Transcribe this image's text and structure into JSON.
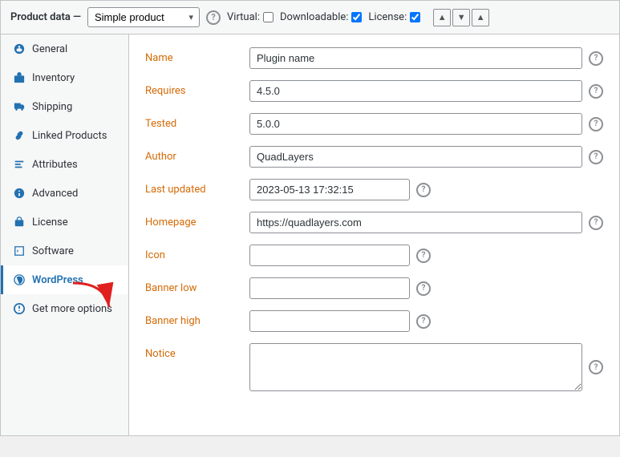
{
  "header": {
    "label": "Product data —",
    "product_type": "Simple product",
    "virtual_label": "Virtual:",
    "virtual_checked": false,
    "downloadable_label": "Downloadable:",
    "downloadable_checked": true,
    "license_label": "License:",
    "license_checked": true
  },
  "sidebar": {
    "items": [
      {
        "id": "general",
        "label": "General",
        "icon": "general"
      },
      {
        "id": "inventory",
        "label": "Inventory",
        "icon": "inventory"
      },
      {
        "id": "shipping",
        "label": "Shipping",
        "icon": "shipping"
      },
      {
        "id": "linked-products",
        "label": "Linked Products",
        "icon": "linked"
      },
      {
        "id": "attributes",
        "label": "Attributes",
        "icon": "attributes"
      },
      {
        "id": "advanced",
        "label": "Advanced",
        "icon": "advanced"
      },
      {
        "id": "license",
        "label": "License",
        "icon": "license"
      },
      {
        "id": "software",
        "label": "Software",
        "icon": "software"
      },
      {
        "id": "wordpress",
        "label": "WordPress",
        "icon": "wordpress",
        "active": true
      },
      {
        "id": "get-more-options",
        "label": "Get more options",
        "icon": "more"
      }
    ]
  },
  "form": {
    "fields": [
      {
        "id": "name",
        "label": "Name",
        "label_color": "orange",
        "type": "text",
        "value": "Plugin name",
        "placeholder": "",
        "short": false
      },
      {
        "id": "requires",
        "label": "Requires",
        "label_color": "orange",
        "type": "text",
        "value": "4.5.0",
        "placeholder": "",
        "short": false
      },
      {
        "id": "tested",
        "label": "Tested",
        "label_color": "orange",
        "type": "text",
        "value": "5.0.0",
        "placeholder": "",
        "short": false
      },
      {
        "id": "author",
        "label": "Author",
        "label_color": "orange",
        "type": "text",
        "value": "QuadLayers",
        "placeholder": "",
        "short": false
      },
      {
        "id": "last_updated",
        "label": "Last updated",
        "label_color": "orange",
        "type": "text",
        "value": "2023-05-13 17:32:15",
        "placeholder": "",
        "short": true
      },
      {
        "id": "homepage",
        "label": "Homepage",
        "label_color": "orange",
        "type": "text",
        "value": "https://quadlayers.com",
        "placeholder": "",
        "short": false
      },
      {
        "id": "icon",
        "label": "Icon",
        "label_color": "orange",
        "type": "text",
        "value": "",
        "placeholder": "",
        "short": true
      },
      {
        "id": "banner_low",
        "label": "Banner low",
        "label_color": "orange",
        "type": "text",
        "value": "",
        "placeholder": "",
        "short": true
      },
      {
        "id": "banner_high",
        "label": "Banner high",
        "label_color": "orange",
        "type": "text",
        "value": "",
        "placeholder": "",
        "short": true
      },
      {
        "id": "notice",
        "label": "Notice",
        "label_color": "orange",
        "type": "textarea",
        "value": "",
        "placeholder": "",
        "short": false
      }
    ]
  }
}
